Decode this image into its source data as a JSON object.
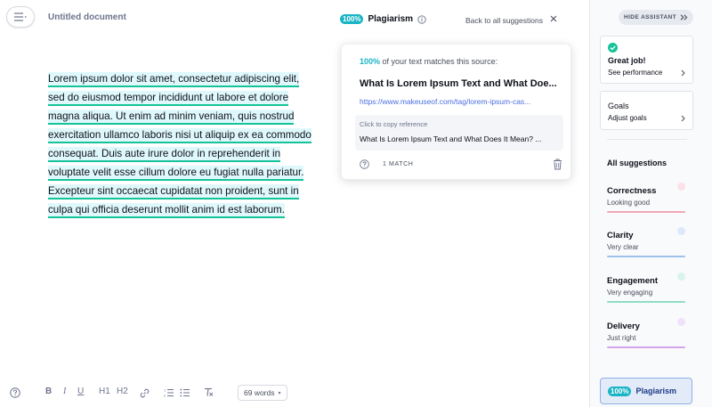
{
  "document": {
    "title": "Untitled document",
    "body": "Lorem ipsum dolor sit amet, consectetur adipiscing elit, sed do eiusmod tempor incididunt ut labore et dolore magna aliqua. Ut enim ad minim veniam, quis nostrud exercitation ullamco laboris nisi ut aliquip ex ea commodo consequat. Duis aute irure dolor in reprehenderit in voluptate velit esse cillum dolore eu fugiat nulla pariatur. Excepteur sint occaecat cupidatat non proident, sunt in culpa qui officia deserunt mollit anim id est laborum."
  },
  "plagiarism_panel": {
    "percent_pill": "100%",
    "title": "Plagiarism",
    "back_label": "Back to all suggestions",
    "match_percent": "100%",
    "match_text": "of your text matches this source:",
    "source_title": "What Is Lorem Ipsum Text and What Doe...",
    "source_url": "https://www.makeuseof.com/tag/lorem-ipsum-cas...",
    "copy_label": "Click to copy reference",
    "reference": "What Is Lorem Ipsum Text and What Does It Mean? ...",
    "match_count": "1 MATCH"
  },
  "toolbar": {
    "bold": "B",
    "italic": "I",
    "underline": "U",
    "h1": "H1",
    "h2": "H2",
    "word_count": "69 words"
  },
  "sidebar": {
    "hide_label": "HIDE ASSISTANT",
    "great_job": {
      "title": "Great job!",
      "subtitle": "See performance"
    },
    "goals": {
      "title": "Goals",
      "subtitle": "Adjust goals"
    },
    "all_suggestions": "All suggestions",
    "categories": [
      {
        "name": "Correctness",
        "status": "Looking good",
        "color": "#f0a8b8"
      },
      {
        "name": "Clarity",
        "status": "Very clear",
        "color": "#9fc1ee"
      },
      {
        "name": "Engagement",
        "status": "Very engaging",
        "color": "#8fdcc6"
      },
      {
        "name": "Delivery",
        "status": "Just right",
        "color": "#d3a6ec"
      }
    ],
    "plagiarism_button": {
      "pill": "100%",
      "label": "Plagiarism"
    }
  },
  "colors": {
    "accent_teal": "#1ab5c5",
    "success_green": "#15c39a",
    "link_blue": "#4a6ee0"
  }
}
